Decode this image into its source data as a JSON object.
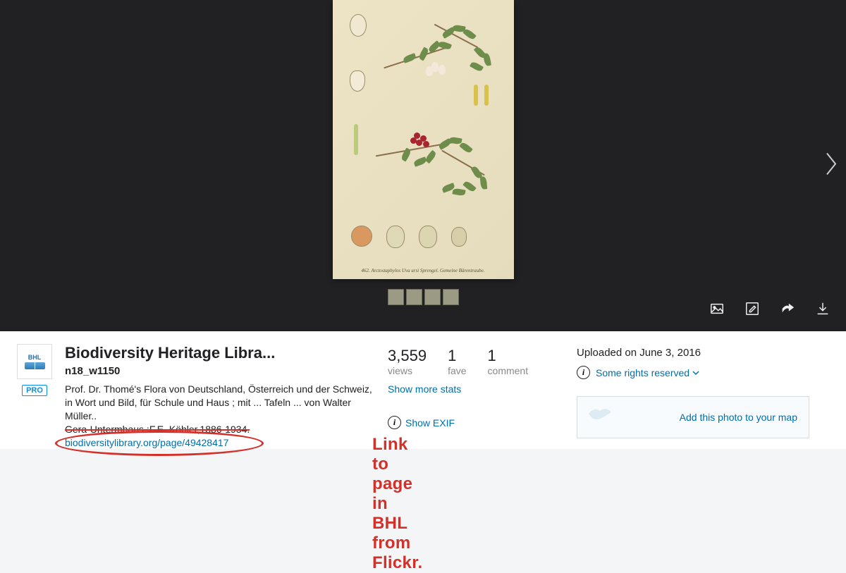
{
  "avatar_label": "BHL",
  "owner": "Biodiversity Heritage Libra...",
  "title": "n18_w1150",
  "pro_badge": "PRO",
  "description": {
    "line1": "Prof. Dr. Thomé's Flora von Deutschland, Österreich und der Schweiz, in Wort und Bild, für Schule und Haus ; mit ... Tafeln ... von Walter Müller..",
    "line2_struck": "Gera-Untermhaus :F.E. Köhler,1886-1934.",
    "link_text": "biodiversitylibrary.org/page/49428417"
  },
  "stats": {
    "views": {
      "value": "3,559",
      "label": "views"
    },
    "faves": {
      "value": "1",
      "label": "fave"
    },
    "comments": {
      "value": "1",
      "label": "comment"
    }
  },
  "show_more_stats": "Show more stats",
  "show_exif": "Show EXIF",
  "upload_text": "Uploaded on June 3, 2016",
  "rights_text": "Some rights reserved",
  "map_cta": "Add this photo to your map",
  "plate_caption": "462. Arctostaphylos Uva ursi Sprengel.   Gemeine Bärentraube.",
  "annotation": "Link to page in BHL from Flickr."
}
